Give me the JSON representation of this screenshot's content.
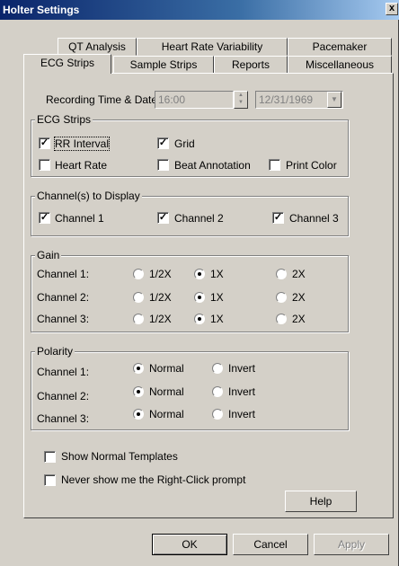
{
  "window": {
    "title": "Holter Settings",
    "close_glyph": "x"
  },
  "tabs_back": [
    "QT Analysis",
    "Heart Rate Variability",
    "Pacemaker"
  ],
  "tabs_front": [
    "ECG Strips",
    "Sample Strips",
    "Reports",
    "Miscellaneous"
  ],
  "active_tab": "ECG Strips",
  "recording": {
    "label": "Recording Time & Date:",
    "time": "16:00",
    "date": "12/31/1969"
  },
  "ecg_strips": {
    "title": "ECG Strips",
    "options": [
      {
        "label": "RR Interval",
        "checked": true
      },
      {
        "label": "Grid",
        "checked": true
      },
      {
        "label": "Heart Rate",
        "checked": false
      },
      {
        "label": "Beat Annotation",
        "checked": false
      },
      {
        "label": "Print Color",
        "checked": false
      }
    ]
  },
  "channels": {
    "title": "Channel(s) to Display",
    "options": [
      {
        "label": "Channel 1",
        "checked": true
      },
      {
        "label": "Channel 2",
        "checked": true
      },
      {
        "label": "Channel 3",
        "checked": true
      }
    ]
  },
  "gain": {
    "title": "Gain",
    "channels": [
      "Channel 1:",
      "Channel 2:",
      "Channel 3:"
    ],
    "options": [
      "1/2X",
      "1X",
      "2X"
    ],
    "selected": [
      "1X",
      "1X",
      "1X"
    ]
  },
  "polarity": {
    "title": "Polarity",
    "channels": [
      "Channel 1:",
      "Channel 2:",
      "Channel 3:"
    ],
    "options": [
      "Normal",
      "Invert"
    ],
    "selected": [
      "Normal",
      "Normal",
      "Normal"
    ]
  },
  "show_normal_templates": {
    "label": "Show Normal Templates",
    "checked": false
  },
  "never_show_prompt": {
    "label": "Never show me the Right-Click prompt",
    "checked": false
  },
  "buttons": {
    "help": "Help",
    "ok": "OK",
    "cancel": "Cancel",
    "apply": "Apply"
  }
}
